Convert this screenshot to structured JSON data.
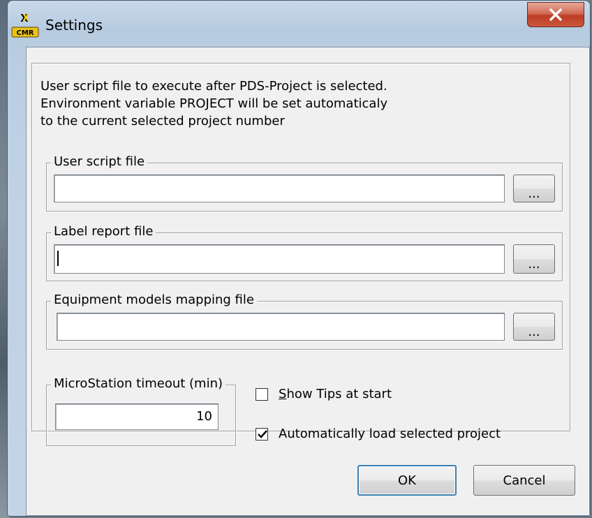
{
  "window": {
    "title": "Settings",
    "app_icon": "app-icon"
  },
  "description": {
    "lines": [
      "User script file to execute after PDS-Project is selected.",
      "Environment variable PROJECT will be set automaticaly",
      "to the current selected project number"
    ]
  },
  "user_script": {
    "label": "User script file",
    "value": "",
    "browse_label": "..."
  },
  "label_report": {
    "label": "Label report file",
    "value": "",
    "browse_label": "..."
  },
  "equipment_mapping": {
    "label": "Equipment models mapping file",
    "value": "",
    "browse_label": "..."
  },
  "timeout": {
    "label": "MicroStation timeout (min)",
    "value": "10"
  },
  "options": {
    "show_tips": {
      "label_underlined": "S",
      "label_rest": "how Tips at start",
      "checked": false
    },
    "auto_load": {
      "label": "Automatically load selected project",
      "checked": true
    }
  },
  "buttons": {
    "ok": "OK",
    "cancel": "Cancel"
  },
  "colors": {
    "close_button": "#c9583d",
    "default_button_border": "#3c7fb1",
    "dialog_background": "#f0f0f0"
  }
}
